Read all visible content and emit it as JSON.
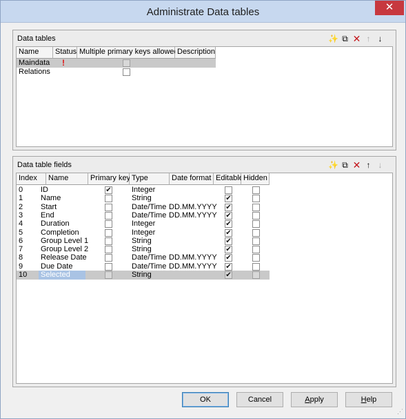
{
  "window": {
    "title": "Administrate Data tables",
    "close_glyph": "✕"
  },
  "data_tables": {
    "title": "Data tables",
    "toolbar": [
      {
        "name": "new-icon",
        "glyph": "✨",
        "enabled": true
      },
      {
        "name": "copy-icon",
        "glyph": "⧉",
        "enabled": true
      },
      {
        "name": "delete-icon",
        "glyph": "✕",
        "enabled": true
      },
      {
        "name": "move-up-icon",
        "glyph": "↑",
        "enabled": false
      },
      {
        "name": "move-down-icon",
        "glyph": "↓",
        "enabled": true
      }
    ],
    "columns": [
      "Name",
      "Status",
      "Multiple primary keys allowed",
      "Description"
    ],
    "rows": [
      {
        "name": "Maindata",
        "status": "!",
        "multiple_primary_keys_allowed": false,
        "description": "",
        "highlighted": true
      },
      {
        "name": "Relations",
        "status": "",
        "multiple_primary_keys_allowed": false,
        "description": "",
        "highlighted": false
      }
    ]
  },
  "data_table_fields": {
    "title": "Data table fields",
    "toolbar": [
      {
        "name": "new-icon",
        "glyph": "✨",
        "enabled": true
      },
      {
        "name": "copy-icon",
        "glyph": "⧉",
        "enabled": true
      },
      {
        "name": "delete-icon",
        "glyph": "✕",
        "enabled": true
      },
      {
        "name": "move-up-icon",
        "glyph": "↑",
        "enabled": true
      },
      {
        "name": "move-down-icon",
        "glyph": "↓",
        "enabled": false
      }
    ],
    "columns": [
      "Index",
      "Name",
      "Primary key",
      "Type",
      "Date format",
      "Editable",
      "Hidden"
    ],
    "rows": [
      {
        "index": "0",
        "name": "ID",
        "primary_key": true,
        "type": "Integer",
        "date_format": "",
        "editable": false,
        "hidden": false
      },
      {
        "index": "1",
        "name": "Name",
        "primary_key": false,
        "type": "String",
        "date_format": "",
        "editable": true,
        "hidden": false
      },
      {
        "index": "2",
        "name": "Start",
        "primary_key": false,
        "type": "Date/Time",
        "date_format": "DD.MM.YYYY",
        "editable": true,
        "hidden": false
      },
      {
        "index": "3",
        "name": "End",
        "primary_key": false,
        "type": "Date/Time",
        "date_format": "DD.MM.YYYY",
        "editable": true,
        "hidden": false
      },
      {
        "index": "4",
        "name": "Duration",
        "primary_key": false,
        "type": "Integer",
        "date_format": "",
        "editable": true,
        "hidden": false
      },
      {
        "index": "5",
        "name": "Completion",
        "primary_key": false,
        "type": "Integer",
        "date_format": "",
        "editable": true,
        "hidden": false
      },
      {
        "index": "6",
        "name": "Group Level 1",
        "primary_key": false,
        "type": "String",
        "date_format": "",
        "editable": true,
        "hidden": false
      },
      {
        "index": "7",
        "name": "Group Level 2",
        "primary_key": false,
        "type": "String",
        "date_format": "",
        "editable": true,
        "hidden": false
      },
      {
        "index": "8",
        "name": "Release Date",
        "primary_key": false,
        "type": "Date/Time",
        "date_format": "DD.MM.YYYY",
        "editable": true,
        "hidden": false
      },
      {
        "index": "9",
        "name": "Due Date",
        "primary_key": false,
        "type": "Date/Time",
        "date_format": "DD.MM.YYYY",
        "editable": true,
        "hidden": false
      },
      {
        "index": "10",
        "name": "Selected",
        "primary_key": false,
        "type": "String",
        "date_format": "",
        "editable": true,
        "hidden": false,
        "highlighted": true
      }
    ]
  },
  "buttons": {
    "ok": "OK",
    "cancel": "Cancel",
    "apply_prefix": "",
    "apply_mnemonic": "A",
    "apply_rest": "pply",
    "help_prefix": "",
    "help_mnemonic": "H",
    "help_rest": "elp"
  },
  "colors": {
    "title_bar": "#c7d8ef",
    "close_button": "#c7383f",
    "row_highlight": "#c9c9c9",
    "cell_selection": "#a9c3e4",
    "status_warning": "#e01010"
  }
}
